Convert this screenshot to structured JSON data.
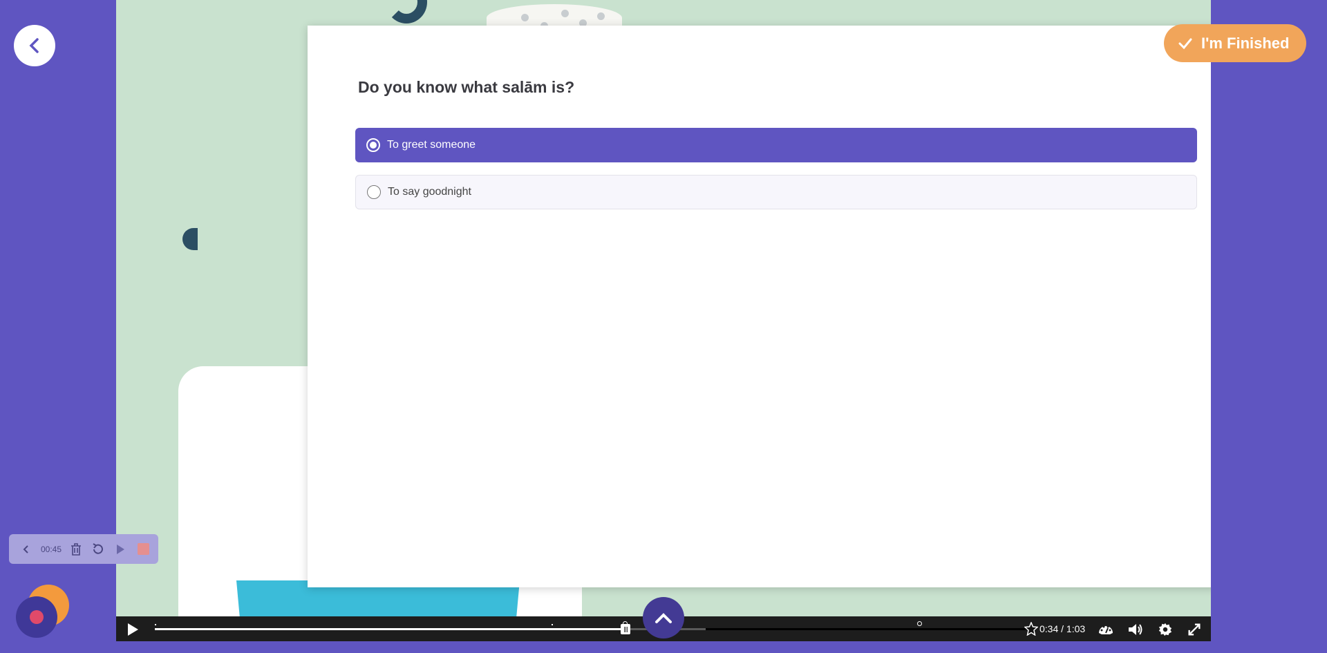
{
  "quiz": {
    "question": "Do you know what salām is?",
    "options": [
      {
        "label": "To greet someone",
        "selected": true
      },
      {
        "label": "To say goodnight",
        "selected": false
      }
    ]
  },
  "header": {
    "finished_label": "I'm Finished"
  },
  "player": {
    "current_time": "0:34",
    "duration": "1:03",
    "time_display": "0:34 / 1:03",
    "progress_fraction": 0.54
  },
  "recorder": {
    "elapsed": "00:45"
  },
  "colors": {
    "background": "#5f55c1",
    "accent": "#5f55c1",
    "finished": "#f1a55a",
    "stage": "#c9e2cf"
  },
  "icons": {
    "back": "chevron-left-icon",
    "finished": "check-icon",
    "play": "play-icon",
    "scroll": "chevron-up-icon"
  }
}
